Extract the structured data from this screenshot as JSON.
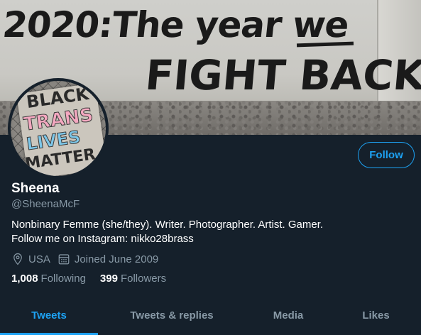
{
  "banner": {
    "graffiti_line1": "2020:The year we",
    "graffiti_line2": "FIGHT BACK"
  },
  "avatar": {
    "sign_words": [
      "BLACK",
      "TRANS",
      "LIVES",
      "MATTER"
    ]
  },
  "profile": {
    "display_name": "Sheena",
    "handle": "@SheenaMcF",
    "bio_line1": "Nonbinary Femme (she/they). Writer. Photographer. Artist. Gamer.",
    "bio_line2": "Follow me on Instagram: nikko28brass",
    "location": "USA",
    "joined": "Joined June 2009",
    "following_count": "1,008",
    "following_label": "Following",
    "followers_count": "399",
    "followers_label": "Followers"
  },
  "actions": {
    "follow_label": "Follow"
  },
  "tabs": [
    {
      "label": "Tweets",
      "active": true
    },
    {
      "label": "Tweets & replies",
      "active": false
    },
    {
      "label": "Media",
      "active": false
    },
    {
      "label": "Likes",
      "active": false
    }
  ],
  "colors": {
    "background": "#15202b",
    "accent": "#1da1f2",
    "secondary_text": "#8899a6",
    "primary_text": "#ffffff"
  },
  "icons": {
    "location": "location-pin-icon",
    "joined": "calendar-icon"
  }
}
